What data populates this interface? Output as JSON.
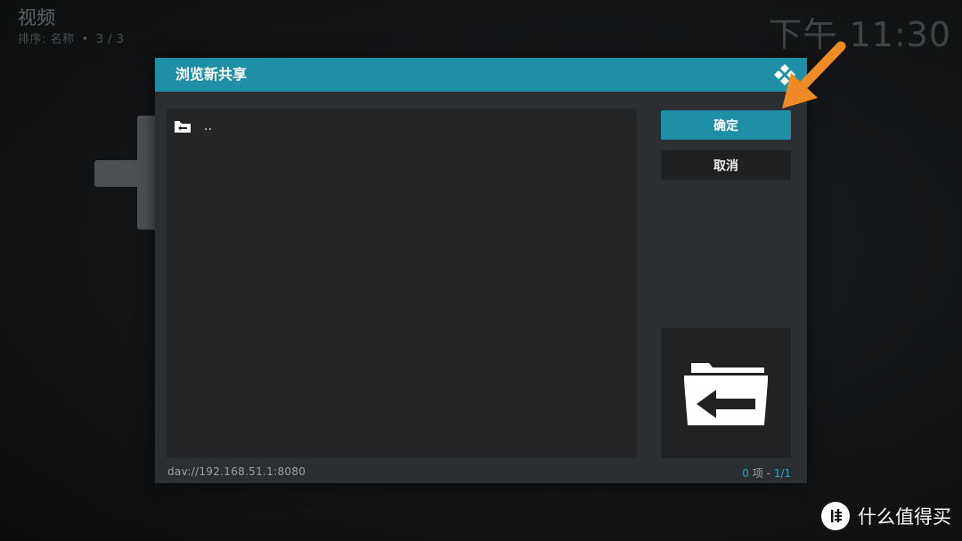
{
  "background": {
    "section_title": "视频",
    "sort_label": "排序: 名称",
    "sort_separator": "•",
    "position": "3 / 3",
    "clock": "下午 11:30"
  },
  "dialog": {
    "title": "浏览新共享",
    "list": [
      {
        "label": "..",
        "icon": "folder-back-icon"
      }
    ],
    "ok_label": "确定",
    "cancel_label": "取消",
    "path": "dav://192.168.51.1:8080",
    "count_text": "0",
    "count_unit": " 项 - ",
    "page_text": "1/1"
  },
  "watermark": {
    "text": "什么值得买",
    "logo_char": "值"
  },
  "colors": {
    "accent": "#1f8fa5",
    "annotation_arrow": "#f08a24"
  }
}
